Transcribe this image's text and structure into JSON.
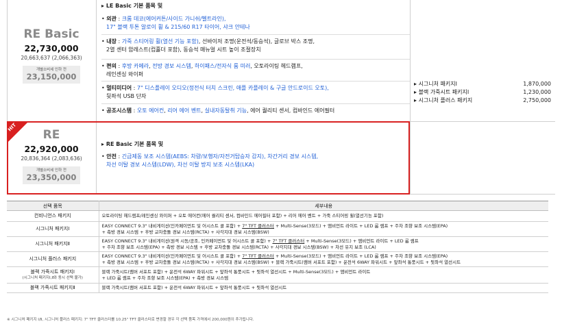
{
  "trims": [
    {
      "name": "RE Basic",
      "price": "22,730,000",
      "sub_price": "20,663,637 (2,066,363)",
      "discount_label": "개별소비세 인하 전",
      "discount_price": "23,150,000"
    },
    {
      "name": "RE",
      "price": "22,920,000",
      "sub_price": "20,836,364 (2,083,636)",
      "discount_label": "개별소비세 인하 전",
      "discount_price": "23,350,000",
      "badge": "HIT"
    }
  ],
  "le_basic": {
    "header": "LE Basic 기본 품목 및",
    "exterior": {
      "label": "외관",
      "line1": "크롬 데코(에어커튼/사이드 가니쉬/벨트라인),",
      "line2": "17\" 블랙 투톤 알로이 휠 & 215/60 R17 타이어, 샤크 안테나"
    },
    "interior": {
      "label": "내장",
      "line1a": "가죽 스티어링 휠(열선 기능 포함)",
      "line1b": ", 선바이저 조명(운전석/동승석), 글로브 박스 조명,",
      "line2": "2열 센터 암레스트(컵홀더 포함), 동승석 매뉴얼 시트 높이 조절장치"
    },
    "convenience": {
      "label": "편의",
      "p1": "후방 카메라",
      "p2": ", ",
      "p3": "전방 경보 시스템",
      "p4": ", ",
      "p5": "하이패스/전자식 룸 미러",
      "p6": ", 오토라이팅 헤드램프,",
      "line2": "레인센싱 와이퍼"
    },
    "multimedia": {
      "label": "멀티미디어",
      "line1": "7\" 디스플레이 오디오(정전식 터치 스크린, 애플 카플레이 & 구글 안드로이드 오토),",
      "line2": "뒷좌석 USB 단자"
    },
    "climate": {
      "label": "공조시스템",
      "p1": "오토 에어컨",
      "p2": ", ",
      "p3": "리어 에어 벤트",
      "p4": ", ",
      "p5": "실내자동탈취 기능",
      "p6": ", 에어 퀄리티 센서, 컴바인드 에어필터"
    }
  },
  "re": {
    "header": "RE Basic 기본 품목 및",
    "safety": {
      "label": "안전",
      "line1": "긴급제동 보조 시스템(AEBS: 차량/보행자/자전거탑승자 감지), 차간거리 경보 시스템,",
      "line2": "차선 이탈 경보 시스템(LDW), 차선 이탈 방지 보조 시스템(LKA)"
    }
  },
  "packages": [
    {
      "name": "시그니처 패키지Ⅰ",
      "price": "1,870,000"
    },
    {
      "name": "블랙 가죽시트 패키지Ⅰ",
      "price": "1,230,000"
    },
    {
      "name": "시그니처 플러스 패키지",
      "price": "2,750,000"
    }
  ],
  "option_table": {
    "col1": "선택 품목",
    "col2": "세부내용",
    "rows": [
      {
        "name": "컨비니언스 패키지",
        "l1": "오토라이팅 헤드램프/레인센싱 와이퍼 + 오토 에어컨(에어 퀄리티 센서, 컴바인드 에어필터 포함) + 리어 에어 벤트 + 가죽 스티어링 휠(열선기능 포함)"
      },
      {
        "name": "시그니처 패키지Ⅰ",
        "l1a": "EASY CONNECT 9.3\" 내비게이션(인카페이먼트 및 어시스트 콜 포함) + ",
        "l1u": "7\" TFT 클러스터",
        "l1b": " + Multi-Sense(3모드) + 앰비언트 라이트 + LED 룸 램프 + 주차 조향 보조 시스템(EPA)",
        "l2": "+ 측방 경보 시스템 + 후방 교차충돌 경보 시스템(RCTA) + 사각지대 경보 시스템(BSW)"
      },
      {
        "name": "시그니처 패키지Ⅱ",
        "l1a": "EASY CONNECT 9.3\" 내비게이션(원격 시동/공조, 인카페이먼트 및 어시스트 콜 포함) + ",
        "l1u": "7\" TFT 클러스터",
        "l1b": " + Multi-Sense(3모드) + 앰비언트 라이트 + LED 룸 램프",
        "l2": "+ 주차 조향 보조 시스템(EPA) + 측방 경보 시스템 + 후방 교차충돌 경보 시스템(RCTA) + 사각지대 경보 시스템(BSW) + 차선 유지 보조 (LCA)"
      },
      {
        "name": "시그니처 플러스 패키지",
        "l1a": "EASY CONNECT 9.3\" 내비게이션(인카페이먼트 및 어시스트 콜 포함) + ",
        "l1u": "7\" TFT 클러스터",
        "l1b": " + Multi-Sense(3모드) + 앰비언트 라이트 + LED 룸 램프 + 주차 조향 보조 시스템(EPA)",
        "l2": "+ 측방 경보 시스템 + 후방 교차충돌 경보 시스템(RCTA) + 사각지대 경보 시스템(BSW) + 블랙 가죽시트(램버 서포트 포함) + 운전석 6WAY 파워시트 + 앞좌석 통풍시트 + 뒷좌석 열선시트"
      },
      {
        "name": "블랙 가죽시트 패키지Ⅰ",
        "note": "(시그니처 패키지Ⅰ,Ⅱ와 동시 선택 불가)",
        "l1": "블랙 가죽시트(램버 서포트 포함) + 운전석 6WAY 파워시트 + 앞좌석 통풍시트 + 뒷좌석 열선시트 + Multi-Sense(3모드) + 앰비언트 라이트",
        "l2": "+ LED 룸 램프 + 주차 조향 보조 시스템(EPA) + 측방 경보 시스템"
      },
      {
        "name": "블랙 가죽시트 패키지Ⅱ",
        "l1": "블랙 가죽시트(램버 서포트 포함) + 운전석 6WAY 파워시트 + 앞좌석 통풍시트 + 뒷좌석 열선시트"
      }
    ]
  },
  "footnote": "※ 시그니처 패키지 Ⅰ/Ⅱ, 시그니처 플러스 패키지: 7\" TFT 클러스터를 10.25\" TFT 클러스터로 변경할 경우 각 선택 품목 가격에서 200,000원이 추가됩니다."
}
